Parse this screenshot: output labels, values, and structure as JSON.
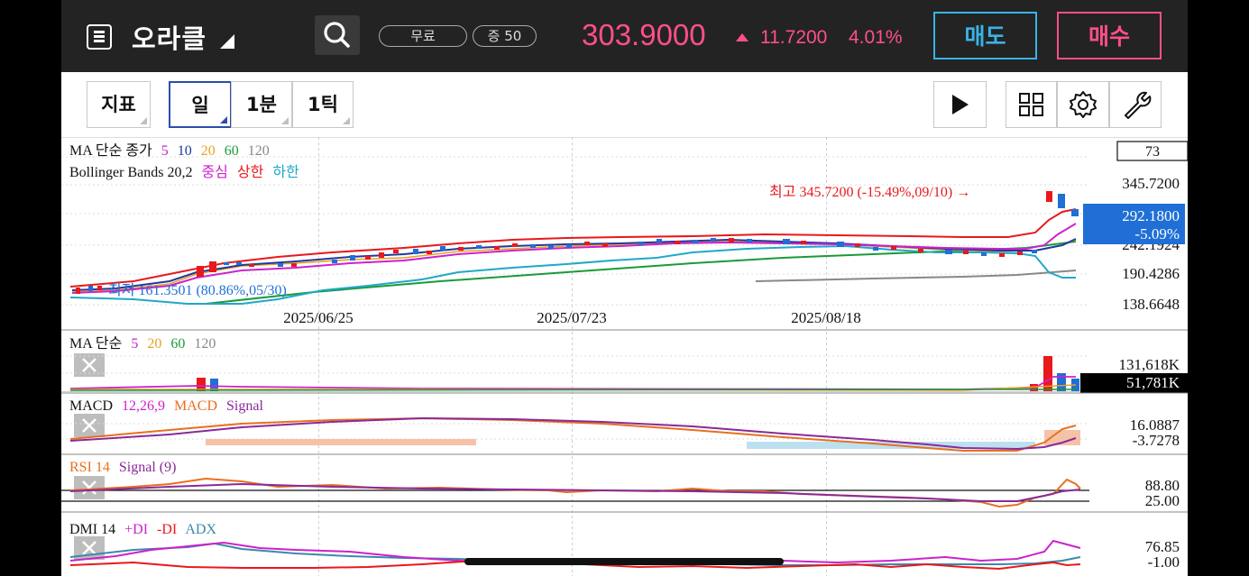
{
  "header": {
    "title": "오라클",
    "badge_free": "무료",
    "badge_margin": "증 50",
    "price": "303.9000",
    "change": "11.7200",
    "change_pct": "4.01%",
    "sell_label": "매도",
    "buy_label": "매수",
    "icons": [
      "menu-icon",
      "dropdown-caret-icon",
      "search-icon"
    ]
  },
  "toolbar": {
    "indicator_label": "지표",
    "period_day": "일",
    "period_1min": "1분",
    "period_1tick": "1틱",
    "icons": [
      "play-icon",
      "grid-layout-icon",
      "gear-icon",
      "wrench-icon"
    ]
  },
  "price_panel": {
    "legend_ma": {
      "label": "MA 단순 종가",
      "periods": [
        "5",
        "10",
        "20",
        "60",
        "120"
      ]
    },
    "legend_bb": {
      "label": "Bollinger Bands 20,2",
      "mid": "중심",
      "upper": "상한",
      "lower": "하한"
    },
    "scale_box": "73",
    "y_ticks": [
      "345.7200",
      "242.1924",
      "190.4286",
      "138.6648"
    ],
    "current_price": "292.1800",
    "current_pct": "-5.09%",
    "high_annotation": "최고 345.7200 (-15.49%,09/10) →",
    "low_annotation": "최저 161.3501 (80.86%,05/30)",
    "x_ticks": [
      "2025/06/25",
      "2025/07/23",
      "2025/08/18"
    ]
  },
  "volume_panel": {
    "legend": {
      "label": "MA 단순",
      "periods": [
        "5",
        "20",
        "60",
        "120"
      ]
    },
    "y_ticks": [
      "131,618K",
      "51,781K"
    ]
  },
  "macd_panel": {
    "legend": {
      "label": "MACD",
      "params": "12,26,9",
      "macd": "MACD",
      "signal": "Signal"
    },
    "y_ticks": [
      "16.0887",
      "-3.7278"
    ]
  },
  "rsi_panel": {
    "legend": {
      "label": "RSI 14",
      "signal": "Signal (9)"
    },
    "y_ticks": [
      "88.80",
      "25.00"
    ]
  },
  "dmi_panel": {
    "legend": {
      "label": "DMI 14",
      "plus": "+DI",
      "minus": "-DI",
      "adx": "ADX"
    },
    "y_ticks": [
      "76.85",
      "-1.00"
    ]
  },
  "colors": {
    "up": "#e8191c",
    "down": "#1f6fd6",
    "accent_pink": "#ff4f8b",
    "accent_cyan": "#39b3e6",
    "ma5": "#cc22cc",
    "ma10": "#1f3a9e",
    "ma20": "#e8a020",
    "ma60": "#1a9a3a",
    "ma120": "#888888",
    "bb_mid": "#cc22cc",
    "bb_upper": "#e8191c",
    "bb_lower": "#20a8c8"
  }
}
